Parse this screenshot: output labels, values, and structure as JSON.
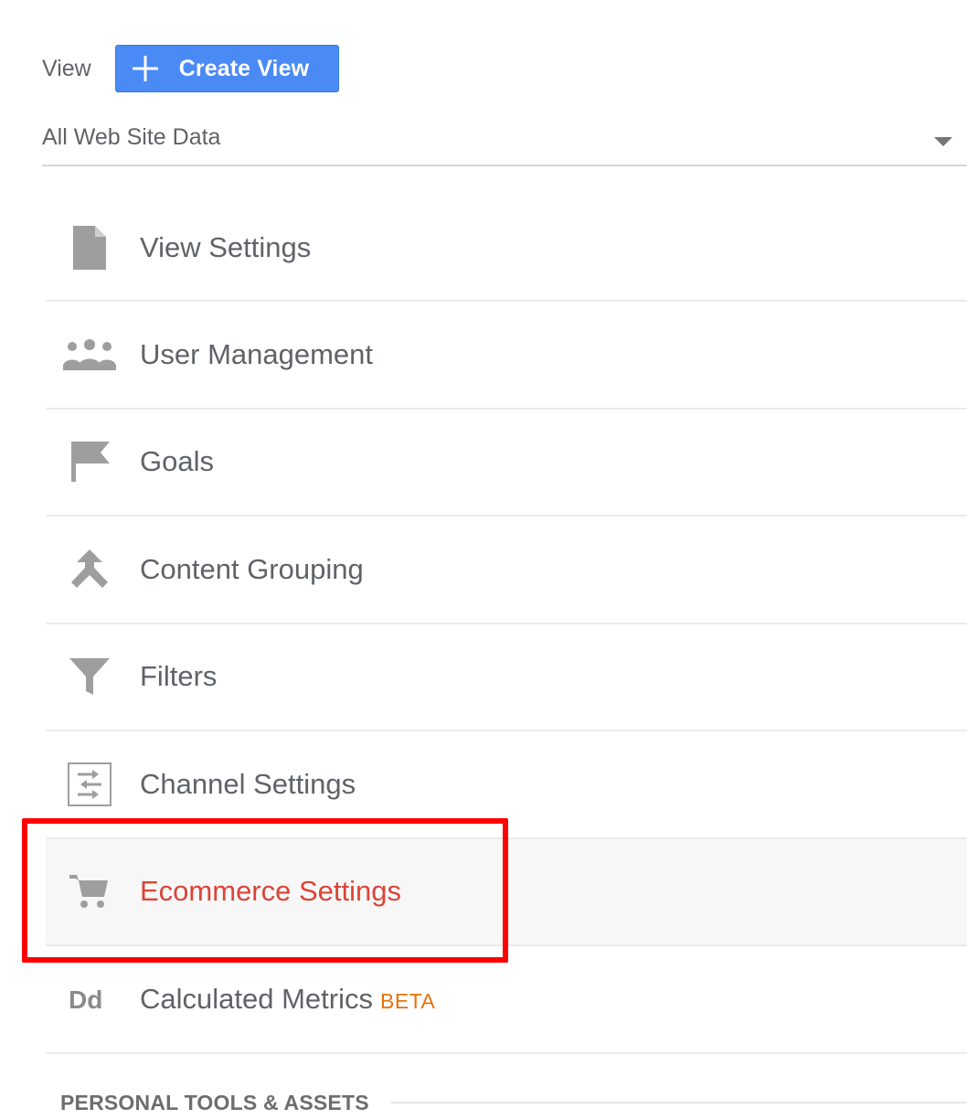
{
  "view": {
    "label": "View",
    "create_button_label": "Create View",
    "selected_view": "All Web Site Data"
  },
  "menu": {
    "items": [
      {
        "label": "View Settings",
        "icon": "document-icon"
      },
      {
        "label": "User Management",
        "icon": "people-icon"
      },
      {
        "label": "Goals",
        "icon": "flag-icon"
      },
      {
        "label": "Content Grouping",
        "icon": "merge-arrow-icon"
      },
      {
        "label": "Filters",
        "icon": "filter-icon"
      },
      {
        "label": "Channel Settings",
        "icon": "channel-settings-icon"
      },
      {
        "label": "Ecommerce Settings",
        "icon": "cart-icon",
        "active": true
      },
      {
        "label": "Calculated Metrics",
        "icon": "calculated-metrics-icon",
        "badge": "BETA"
      }
    ]
  },
  "section": {
    "title": "PERSONAL TOOLS & ASSETS"
  },
  "colors": {
    "primary_button": "#4a8af4",
    "active_item_text": "#db4437",
    "beta_badge": "#e8710a",
    "highlight": "#ff0000"
  }
}
